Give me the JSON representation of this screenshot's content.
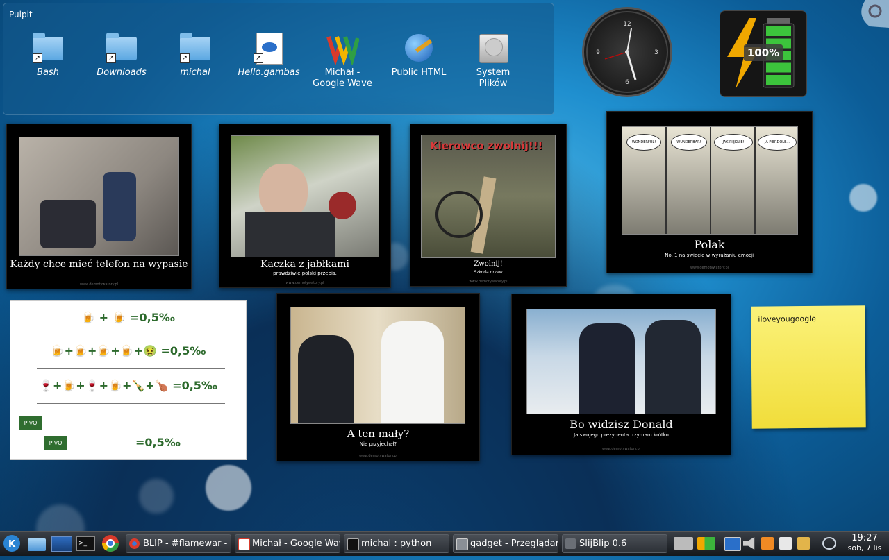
{
  "folderview": {
    "title": "Pulpit",
    "icons": [
      {
        "label": "Bash"
      },
      {
        "label": "Downloads"
      },
      {
        "label": "michal"
      },
      {
        "label": "Hello.gambas"
      },
      {
        "label": "Michał - Google Wave"
      },
      {
        "label": "Public HTML"
      },
      {
        "label": "System Plików"
      }
    ]
  },
  "battery": {
    "percent_text": "100%",
    "charge_fraction": 1.0
  },
  "clock_widget": {
    "numbers": [
      "12",
      "3",
      "6",
      "9"
    ]
  },
  "frames": [
    {
      "caption": "Każdy chce mieć telefon na wypasie",
      "sub": "",
      "url": "www.demotywatory.pl"
    },
    {
      "caption": "Kaczka z jabłkami",
      "sub": "prawdziwie polski przepis.",
      "url": "www.demotywatory.pl"
    },
    {
      "banner": "Kierowco zwolnij!!!",
      "caption": "Zwolnij!",
      "sub": "Szkoda drzew",
      "url": "www.demotywatory.pl"
    },
    {
      "caption": "Polak",
      "sub": "No. 1 na świecie w wyrażaniu emocji",
      "url": "www.demotywatory.pl",
      "bubbles": [
        "WONDERFUL!",
        "WUNDERBAR!",
        "JAK PIĘKNIE!",
        "JA PIERDOLE..."
      ]
    },
    {
      "caption": "A ten mały?",
      "sub": "Nie przyjechał?",
      "url": "www.demotywatory.pl"
    },
    {
      "caption": "Bo widzisz Donald",
      "sub": "Ja swojego prezydenta trzymam krótko",
      "url": "www.demotywatory.pl"
    }
  ],
  "beer": {
    "result": "=0,5‰",
    "pivo": "PIVO"
  },
  "note": {
    "text": "iloveyougoogle"
  },
  "taskbar": {
    "tasks": [
      {
        "label": "BLIP - #flamewar -"
      },
      {
        "label": "Michał - Google Wav"
      },
      {
        "label": "michal : python"
      },
      {
        "label": "gadget - Przeglądar"
      },
      {
        "label": "SlijBlip 0.6"
      }
    ],
    "time": "19:27",
    "date": "sob, 7 lis"
  }
}
